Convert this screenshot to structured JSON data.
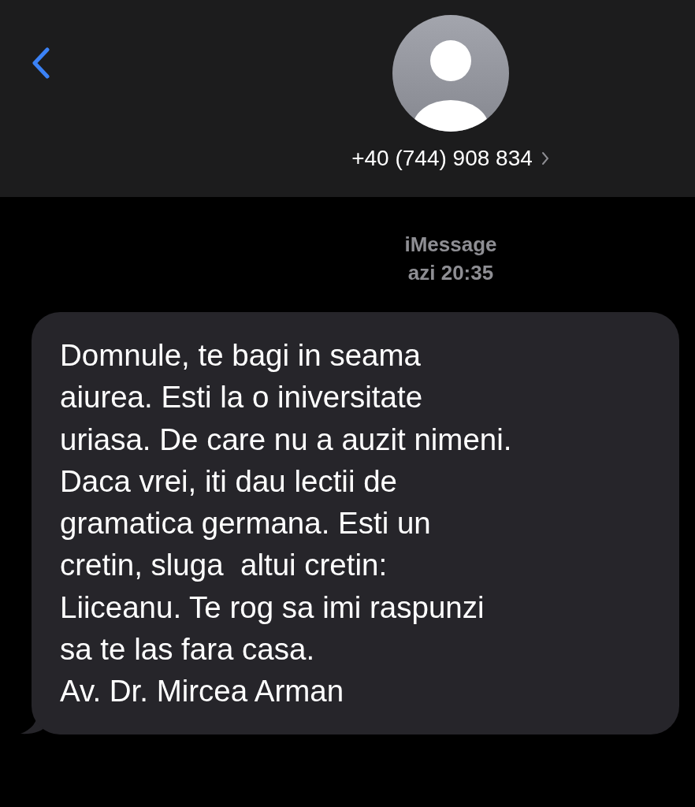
{
  "header": {
    "contact": "+40 (744) 908 834"
  },
  "service": "iMessage",
  "timestamp": "azi 20:35",
  "messages": [
    {
      "text": "Domnule, te bagi in seama\naiurea. Esti la o iniversitate\nuriasa. De care nu a auzit nimeni.\nDaca vrei, iti dau lectii de\ngramatica germana. Esti un\ncretin, sluga  altui cretin:\nLiiceanu. Te rog sa imi raspunzi\nsa te las fara casa.\nAv. Dr. Mircea Arman"
    }
  ]
}
